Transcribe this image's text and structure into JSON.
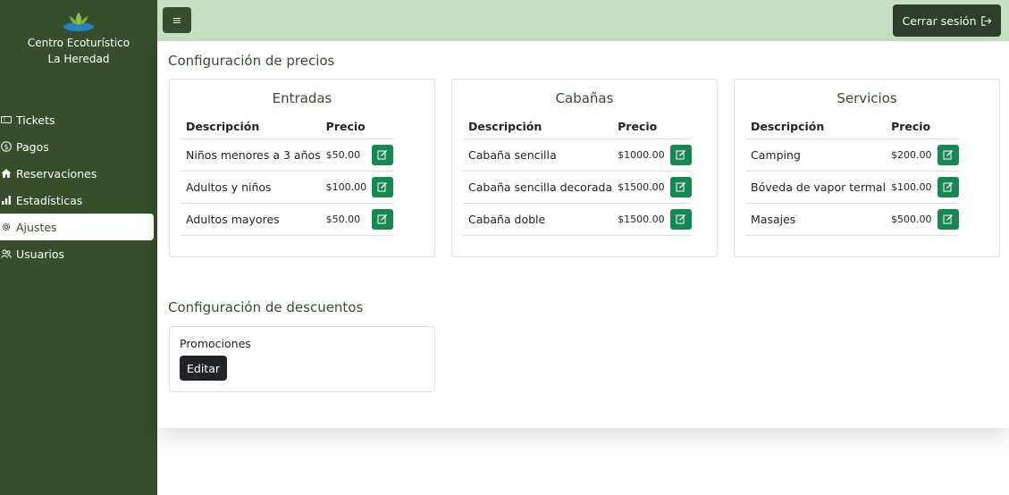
{
  "brand": {
    "line1": "Centro Ecoturístico",
    "line2": "La Heredad",
    "logo_icon": "lotus-icon"
  },
  "nav": [
    {
      "label": "Tickets",
      "icon": "ticket-icon",
      "active": false
    },
    {
      "label": "Pagos",
      "icon": "dollar-circle-icon",
      "active": false
    },
    {
      "label": "Reservaciones",
      "icon": "house-icon",
      "active": false
    },
    {
      "label": "Estadísticas",
      "icon": "bar-chart-icon",
      "active": false
    },
    {
      "label": "Ajustes",
      "icon": "gear-icon",
      "active": true
    },
    {
      "label": "Usuarios",
      "icon": "people-icon",
      "active": false
    }
  ],
  "topbar": {
    "menu_icon": "hamburger-icon",
    "logout_label": "Cerrar sesión",
    "logout_icon": "logout-icon"
  },
  "precios": {
    "title": "Configuración de precios",
    "header_desc": "Descripción",
    "header_price": "Precio",
    "entradas": {
      "title": "Entradas",
      "rows": [
        {
          "desc": "Niños menores a 3 años",
          "price": "$50.00"
        },
        {
          "desc": "Adultos y niños",
          "price": "$100.00"
        },
        {
          "desc": "Adultos mayores",
          "price": "$50.00"
        }
      ]
    },
    "cabanas": {
      "title": "Cabañas",
      "rows": [
        {
          "desc": "Cabaña sencilla",
          "price": "$1000.00"
        },
        {
          "desc": "Cabaña sencilla decorada",
          "price": "$1500.00"
        },
        {
          "desc": "Cabaña doble",
          "price": "$1500.00"
        }
      ]
    },
    "servicios": {
      "title": "Servicios",
      "rows": [
        {
          "desc": "Camping",
          "price": "$200.00"
        },
        {
          "desc": "Bóveda de vapor termal",
          "price": "$100.00"
        },
        {
          "desc": "Masajes",
          "price": "$500.00"
        }
      ]
    }
  },
  "descuentos": {
    "title": "Configuración de descuentos",
    "promo_label": "Promociones",
    "edit_label": "Editar"
  },
  "colors": {
    "sidebar": "#364e2b",
    "topbar": "#c4dfc1",
    "edit": "#198754",
    "logout": "#2f3d2b"
  }
}
